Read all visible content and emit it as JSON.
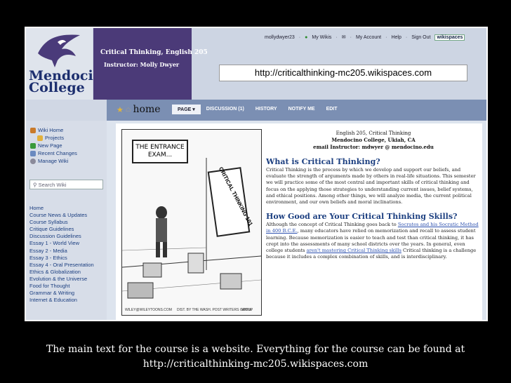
{
  "header": {
    "college_name": [
      "Mendocino",
      "College"
    ],
    "banner_line1": "Critical Thinking, English 205",
    "banner_line2": "Instructor: Molly Dwyer",
    "url_overlay": "http://criticalthinking-mc205.wikispaces.com"
  },
  "topnav": {
    "user": "mollydwyer23",
    "items": [
      "My Wikis",
      "My Account",
      "Help",
      "Sign Out"
    ],
    "brand": "wikispaces"
  },
  "navbar": {
    "home_label": "home",
    "tabs": [
      "PAGE",
      "DISCUSSION (1)",
      "HISTORY",
      "NOTIFY ME",
      "EDIT"
    ]
  },
  "sidebar": {
    "wiki_nav": [
      "Wiki Home",
      "Projects",
      "New Page",
      "Recent Changes",
      "Manage Wiki"
    ],
    "search_placeholder": "Search Wiki",
    "links": [
      "Home",
      "Course News & Updates",
      "Course Syllabus",
      "Critique Guidelines",
      "Discussion Guidelines",
      "Essay 1 - World View",
      "Essay 2 - Media",
      "Essay 3 - Ethics",
      "Essay 4 - Oral Presentation",
      "Ethics & Globalization",
      "Evolution & the Universe",
      "Food for Thought",
      "Grammar & Writing",
      "Internet & Education"
    ]
  },
  "cartoon": {
    "caption": "THE ENTRANCE EXAM...",
    "sign": "CRITICAL THINKING 101",
    "credits": [
      "WILEY@WILEYTOONS.COM",
      "DIST. BY THE WASH. POST WRITERS GROUP",
      "WWW."
    ]
  },
  "content": {
    "course_header": [
      "English 205, Critical Thinking",
      "Mendocino College, Ukiah, CA",
      "email Instructor: mdwyer @ mendocino.edu"
    ],
    "section1_title": "What is Critical Thinking?",
    "section1_text": "Critical Thinking is the process by which we develop and support our beliefs, and evaluate the strength of arguments made by others in real-life situations. This semester we will practice some of the most central and important skills of critical thinking and focus on the applying those strategies to understanding current issues, belief systems, and ethical positions. Among other things, we will analyze media, the current political environment, and our own beliefs and moral inclinations.",
    "section2_title": "How Good are Your Critical Thinking Skills?",
    "section2_text_a": "Although the concept of Critical Thinking goes back to ",
    "section2_link1": "Socrates and his Socratic Method in 400 B.C.E.",
    "section2_text_b": ", many educators have relied on memorization and recall to assess student learning. Because memorization is easier to teach and test than critical thinking, it has crept into the assessments of many school districts over the years. In general, even college students ",
    "section2_link2": "aren't mastering Critical Thinking skills",
    "section2_text_c": " Critical thinking is a challenge because it includes a complex combination of skills, and is interdisciplinary."
  },
  "slide_caption": [
    "The main text for the course is a website. Everything for the course can be found at",
    "http://criticalthinking-mc205.wikispaces.com"
  ]
}
